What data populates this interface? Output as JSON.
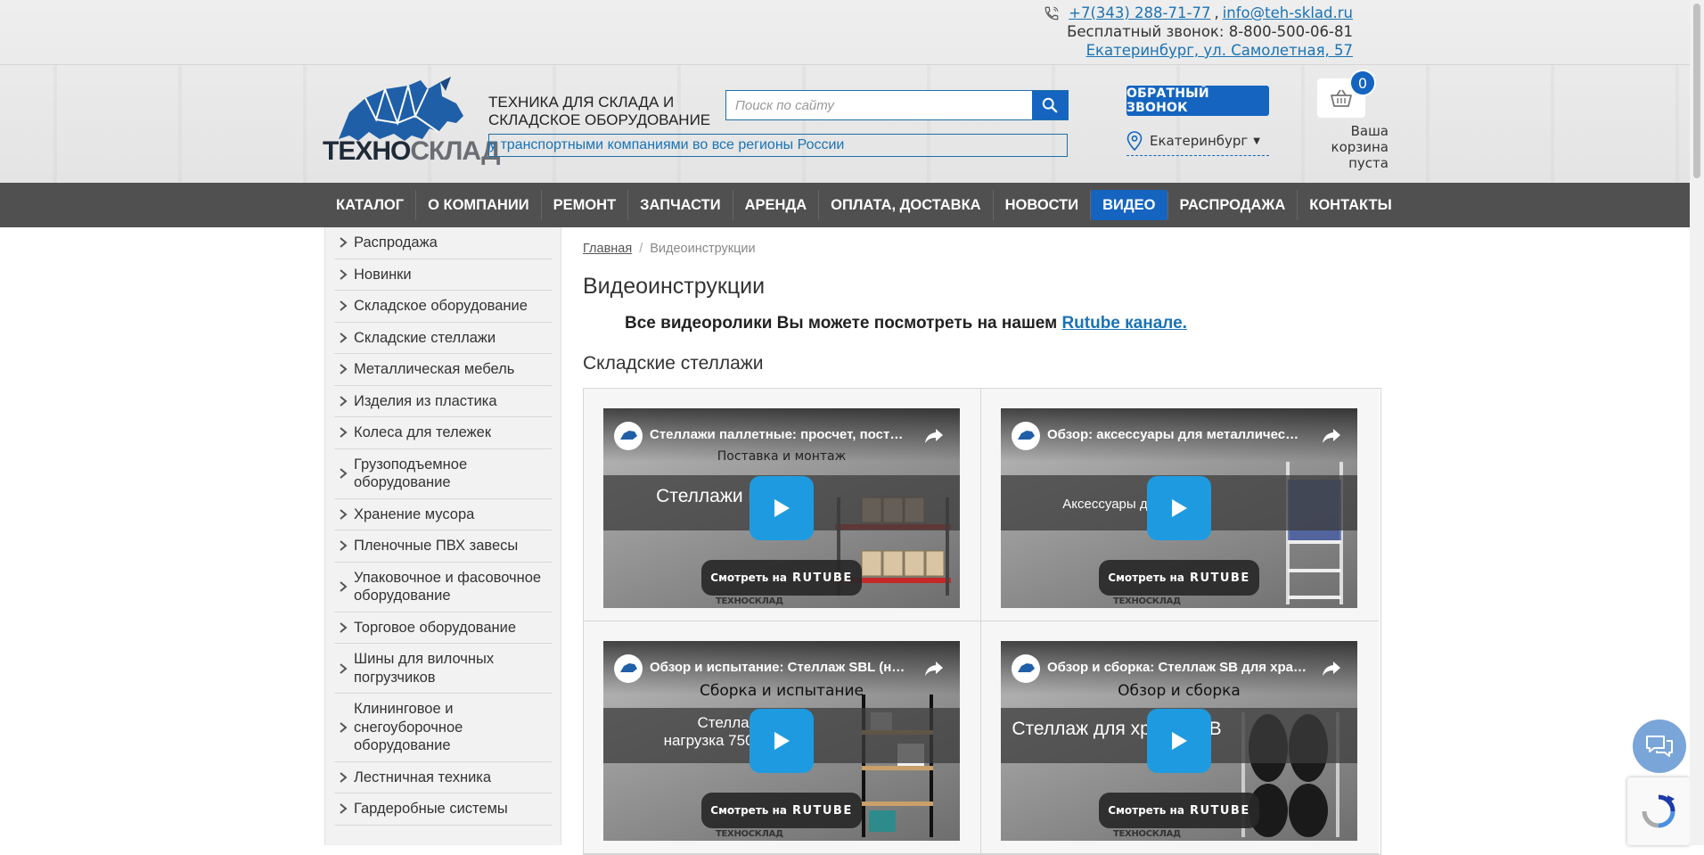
{
  "header": {
    "phone": "+7(343) 288-71-77",
    "phone_sep": ",",
    "email": "info@teh-sklad.ru",
    "free_call": "Бесплатный звонок: 8-800-500-06-81",
    "address": "Екатеринбург, ул. Самолетная, 57",
    "logo_part1": "ТЕХНО",
    "logo_part2": "СКЛАД",
    "slogan_line1": "ТЕХНИКА ДЛЯ СКЛАДА И",
    "slogan_line2": "СКЛАДСКОЕ ОБОРУДОВАНИЕ",
    "search_placeholder": "Поиск по сайту",
    "ticker": "у транспортными компаниями во все регионы России",
    "callback_label": "ОБРАТНЫЙ ЗВОНОК",
    "city": "Екатеринбург",
    "cart_count": "0",
    "cart_text": "Ваша корзина пуста"
  },
  "nav": {
    "items": [
      {
        "label": "КАТАЛОГ"
      },
      {
        "label": "О КОМПАНИИ"
      },
      {
        "label": "РЕМОНТ"
      },
      {
        "label": "ЗАПЧАСТИ"
      },
      {
        "label": "АРЕНДА"
      },
      {
        "label": "ОПЛАТА, ДОСТАВКА"
      },
      {
        "label": "НОВОСТИ"
      },
      {
        "label": "ВИДЕО",
        "active": true
      },
      {
        "label": "РАСПРОДАЖА"
      },
      {
        "label": "КОНТАКТЫ"
      }
    ]
  },
  "sidebar": {
    "items": [
      "Распродажа",
      "Новинки",
      "Складское оборудование",
      "Складские стеллажи",
      "Металлическая мебель",
      "Изделия из пластика",
      "Колеса для тележек",
      "Грузоподъемное оборудование",
      "Хранение мусора",
      "Пленочные ПВХ завесы",
      "Упаковочное и фасовочное оборудование",
      "Торговое оборудование",
      "Шины для вилочных погрузчиков",
      "Клининговое и снегоуборочное оборудование",
      "Лестничная техника",
      "Гардеробные системы"
    ]
  },
  "main": {
    "breadcrumb_home": "Главная",
    "breadcrumb_sep": "/",
    "breadcrumb_current": "Видеоинструкции",
    "title": "Видеоинструкции",
    "intro_text": "Все видеоролики Вы можете посмотреть на нашем ",
    "intro_link": "Rutube канале.",
    "section_title": "Складские стеллажи",
    "watch_on": "Смотреть на",
    "rutube": "RUTUBE",
    "watermark": "ТЕХНОСКЛАД",
    "videos": [
      {
        "title": "Стеллажи паллетные: просчет, пост…",
        "subtitle": "Поставка и монтаж",
        "band": "Стеллажи      ные"
      },
      {
        "title": "Обзор: аксессуары для металличес…",
        "subtitle": "",
        "band": "Аксессуары для          й MS"
      },
      {
        "title": "Обзор и испытание: Стеллаж SBL (н…",
        "subtitle": "Сборка и испытание",
        "band": "Стеллажи\nнагрузка 750 кг      лаж"
      },
      {
        "title": "Обзор и сборка: Стеллаж SB для хра…",
        "subtitle": "Обзор и сборка",
        "band": "Стеллаж для хр        шин SB"
      }
    ]
  },
  "colors": {
    "accent": "#1565c0",
    "nav_bg": "#505050",
    "link": "#1a73b5",
    "play": "#1e9be0"
  }
}
